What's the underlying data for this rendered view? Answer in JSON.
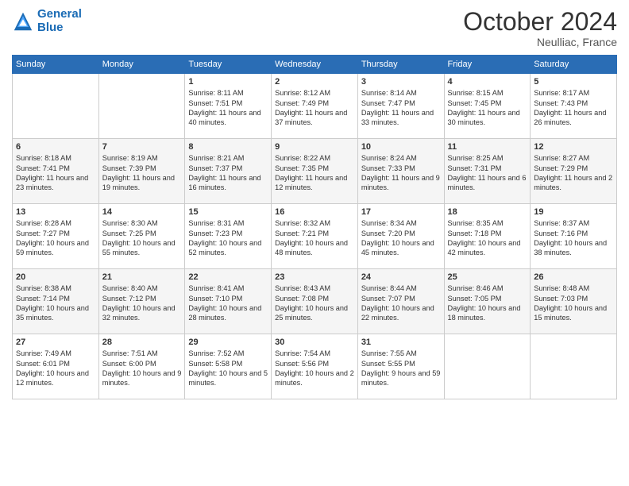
{
  "logo": {
    "line1": "General",
    "line2": "Blue"
  },
  "title": "October 2024",
  "location": "Neulliac, France",
  "days_header": [
    "Sunday",
    "Monday",
    "Tuesday",
    "Wednesday",
    "Thursday",
    "Friday",
    "Saturday"
  ],
  "weeks": [
    [
      {
        "day": "",
        "sunrise": "",
        "sunset": "",
        "daylight": ""
      },
      {
        "day": "",
        "sunrise": "",
        "sunset": "",
        "daylight": ""
      },
      {
        "day": "1",
        "sunrise": "Sunrise: 8:11 AM",
        "sunset": "Sunset: 7:51 PM",
        "daylight": "Daylight: 11 hours and 40 minutes."
      },
      {
        "day": "2",
        "sunrise": "Sunrise: 8:12 AM",
        "sunset": "Sunset: 7:49 PM",
        "daylight": "Daylight: 11 hours and 37 minutes."
      },
      {
        "day": "3",
        "sunrise": "Sunrise: 8:14 AM",
        "sunset": "Sunset: 7:47 PM",
        "daylight": "Daylight: 11 hours and 33 minutes."
      },
      {
        "day": "4",
        "sunrise": "Sunrise: 8:15 AM",
        "sunset": "Sunset: 7:45 PM",
        "daylight": "Daylight: 11 hours and 30 minutes."
      },
      {
        "day": "5",
        "sunrise": "Sunrise: 8:17 AM",
        "sunset": "Sunset: 7:43 PM",
        "daylight": "Daylight: 11 hours and 26 minutes."
      }
    ],
    [
      {
        "day": "6",
        "sunrise": "Sunrise: 8:18 AM",
        "sunset": "Sunset: 7:41 PM",
        "daylight": "Daylight: 11 hours and 23 minutes."
      },
      {
        "day": "7",
        "sunrise": "Sunrise: 8:19 AM",
        "sunset": "Sunset: 7:39 PM",
        "daylight": "Daylight: 11 hours and 19 minutes."
      },
      {
        "day": "8",
        "sunrise": "Sunrise: 8:21 AM",
        "sunset": "Sunset: 7:37 PM",
        "daylight": "Daylight: 11 hours and 16 minutes."
      },
      {
        "day": "9",
        "sunrise": "Sunrise: 8:22 AM",
        "sunset": "Sunset: 7:35 PM",
        "daylight": "Daylight: 11 hours and 12 minutes."
      },
      {
        "day": "10",
        "sunrise": "Sunrise: 8:24 AM",
        "sunset": "Sunset: 7:33 PM",
        "daylight": "Daylight: 11 hours and 9 minutes."
      },
      {
        "day": "11",
        "sunrise": "Sunrise: 8:25 AM",
        "sunset": "Sunset: 7:31 PM",
        "daylight": "Daylight: 11 hours and 6 minutes."
      },
      {
        "day": "12",
        "sunrise": "Sunrise: 8:27 AM",
        "sunset": "Sunset: 7:29 PM",
        "daylight": "Daylight: 11 hours and 2 minutes."
      }
    ],
    [
      {
        "day": "13",
        "sunrise": "Sunrise: 8:28 AM",
        "sunset": "Sunset: 7:27 PM",
        "daylight": "Daylight: 10 hours and 59 minutes."
      },
      {
        "day": "14",
        "sunrise": "Sunrise: 8:30 AM",
        "sunset": "Sunset: 7:25 PM",
        "daylight": "Daylight: 10 hours and 55 minutes."
      },
      {
        "day": "15",
        "sunrise": "Sunrise: 8:31 AM",
        "sunset": "Sunset: 7:23 PM",
        "daylight": "Daylight: 10 hours and 52 minutes."
      },
      {
        "day": "16",
        "sunrise": "Sunrise: 8:32 AM",
        "sunset": "Sunset: 7:21 PM",
        "daylight": "Daylight: 10 hours and 48 minutes."
      },
      {
        "day": "17",
        "sunrise": "Sunrise: 8:34 AM",
        "sunset": "Sunset: 7:20 PM",
        "daylight": "Daylight: 10 hours and 45 minutes."
      },
      {
        "day": "18",
        "sunrise": "Sunrise: 8:35 AM",
        "sunset": "Sunset: 7:18 PM",
        "daylight": "Daylight: 10 hours and 42 minutes."
      },
      {
        "day": "19",
        "sunrise": "Sunrise: 8:37 AM",
        "sunset": "Sunset: 7:16 PM",
        "daylight": "Daylight: 10 hours and 38 minutes."
      }
    ],
    [
      {
        "day": "20",
        "sunrise": "Sunrise: 8:38 AM",
        "sunset": "Sunset: 7:14 PM",
        "daylight": "Daylight: 10 hours and 35 minutes."
      },
      {
        "day": "21",
        "sunrise": "Sunrise: 8:40 AM",
        "sunset": "Sunset: 7:12 PM",
        "daylight": "Daylight: 10 hours and 32 minutes."
      },
      {
        "day": "22",
        "sunrise": "Sunrise: 8:41 AM",
        "sunset": "Sunset: 7:10 PM",
        "daylight": "Daylight: 10 hours and 28 minutes."
      },
      {
        "day": "23",
        "sunrise": "Sunrise: 8:43 AM",
        "sunset": "Sunset: 7:08 PM",
        "daylight": "Daylight: 10 hours and 25 minutes."
      },
      {
        "day": "24",
        "sunrise": "Sunrise: 8:44 AM",
        "sunset": "Sunset: 7:07 PM",
        "daylight": "Daylight: 10 hours and 22 minutes."
      },
      {
        "day": "25",
        "sunrise": "Sunrise: 8:46 AM",
        "sunset": "Sunset: 7:05 PM",
        "daylight": "Daylight: 10 hours and 18 minutes."
      },
      {
        "day": "26",
        "sunrise": "Sunrise: 8:48 AM",
        "sunset": "Sunset: 7:03 PM",
        "daylight": "Daylight: 10 hours and 15 minutes."
      }
    ],
    [
      {
        "day": "27",
        "sunrise": "Sunrise: 7:49 AM",
        "sunset": "Sunset: 6:01 PM",
        "daylight": "Daylight: 10 hours and 12 minutes."
      },
      {
        "day": "28",
        "sunrise": "Sunrise: 7:51 AM",
        "sunset": "Sunset: 6:00 PM",
        "daylight": "Daylight: 10 hours and 9 minutes."
      },
      {
        "day": "29",
        "sunrise": "Sunrise: 7:52 AM",
        "sunset": "Sunset: 5:58 PM",
        "daylight": "Daylight: 10 hours and 5 minutes."
      },
      {
        "day": "30",
        "sunrise": "Sunrise: 7:54 AM",
        "sunset": "Sunset: 5:56 PM",
        "daylight": "Daylight: 10 hours and 2 minutes."
      },
      {
        "day": "31",
        "sunrise": "Sunrise: 7:55 AM",
        "sunset": "Sunset: 5:55 PM",
        "daylight": "Daylight: 9 hours and 59 minutes."
      },
      {
        "day": "",
        "sunrise": "",
        "sunset": "",
        "daylight": ""
      },
      {
        "day": "",
        "sunrise": "",
        "sunset": "",
        "daylight": ""
      }
    ]
  ]
}
